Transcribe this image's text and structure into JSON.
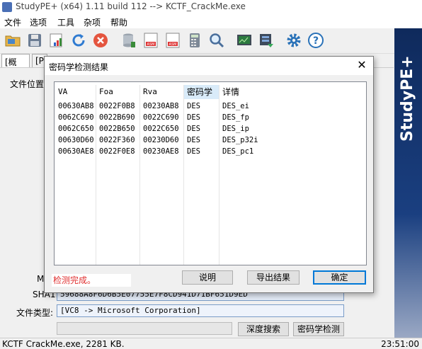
{
  "window": {
    "title": "StudyPE+ (x64) 1.11 build 112  -->  KCTF_CrackMe.exe"
  },
  "menu": [
    "文件",
    "选项",
    "工具",
    "杂项",
    "帮助"
  ],
  "toolbar": {
    "icons": [
      "open-folder-icon",
      "save-icon",
      "properties-icon",
      "refresh-icon",
      "stop-icon",
      "database-icon",
      "asm-icon",
      "asm-alt-icon",
      "calculator-icon",
      "search-icon",
      "monitor-icon",
      "export-icon",
      "settings-icon",
      "help-icon"
    ]
  },
  "tabs": [
    "[概况]",
    "[PE"
  ],
  "main": {
    "file_location_label": "文件位置",
    "md5_label": "MD",
    "sha1_label": "SHA1:",
    "sha1_value": "59688A8F6D6B5E07755E7F8CD941D71BF651D9ED",
    "file_type_label": "文件类型:",
    "file_type_value": "[VC8 -> Microsoft Corporation]",
    "deep_search_button": "深度搜索",
    "crypto_detect_button": "密码学检测"
  },
  "side_banner": "StudyPE+",
  "statusbar": {
    "left": "KCTF CrackMe.exe,  2281 KB.",
    "right": "23:51:00"
  },
  "dialog": {
    "title": "密码学检测结果",
    "close_glyph": "✕",
    "columns": [
      "VA",
      "Foa",
      "Rva",
      "密码学",
      "详情"
    ],
    "rows": [
      [
        "00630AB8",
        "0022F0B8",
        "00230AB8",
        "DES",
        "DES_ei"
      ],
      [
        "0062C690",
        "0022B690",
        "0022C690",
        "DES",
        "DES_fp"
      ],
      [
        "0062C650",
        "0022B650",
        "0022C650",
        "DES",
        "DES_ip"
      ],
      [
        "00630D60",
        "0022F360",
        "00230D60",
        "DES",
        "DES_p32i"
      ],
      [
        "00630AE8",
        "0022F0E8",
        "00230AE8",
        "DES",
        "DES_pc1"
      ]
    ],
    "status_text": "检测完成。",
    "buttons": {
      "explain": "说明",
      "export": "导出结果",
      "ok": "确定"
    }
  }
}
